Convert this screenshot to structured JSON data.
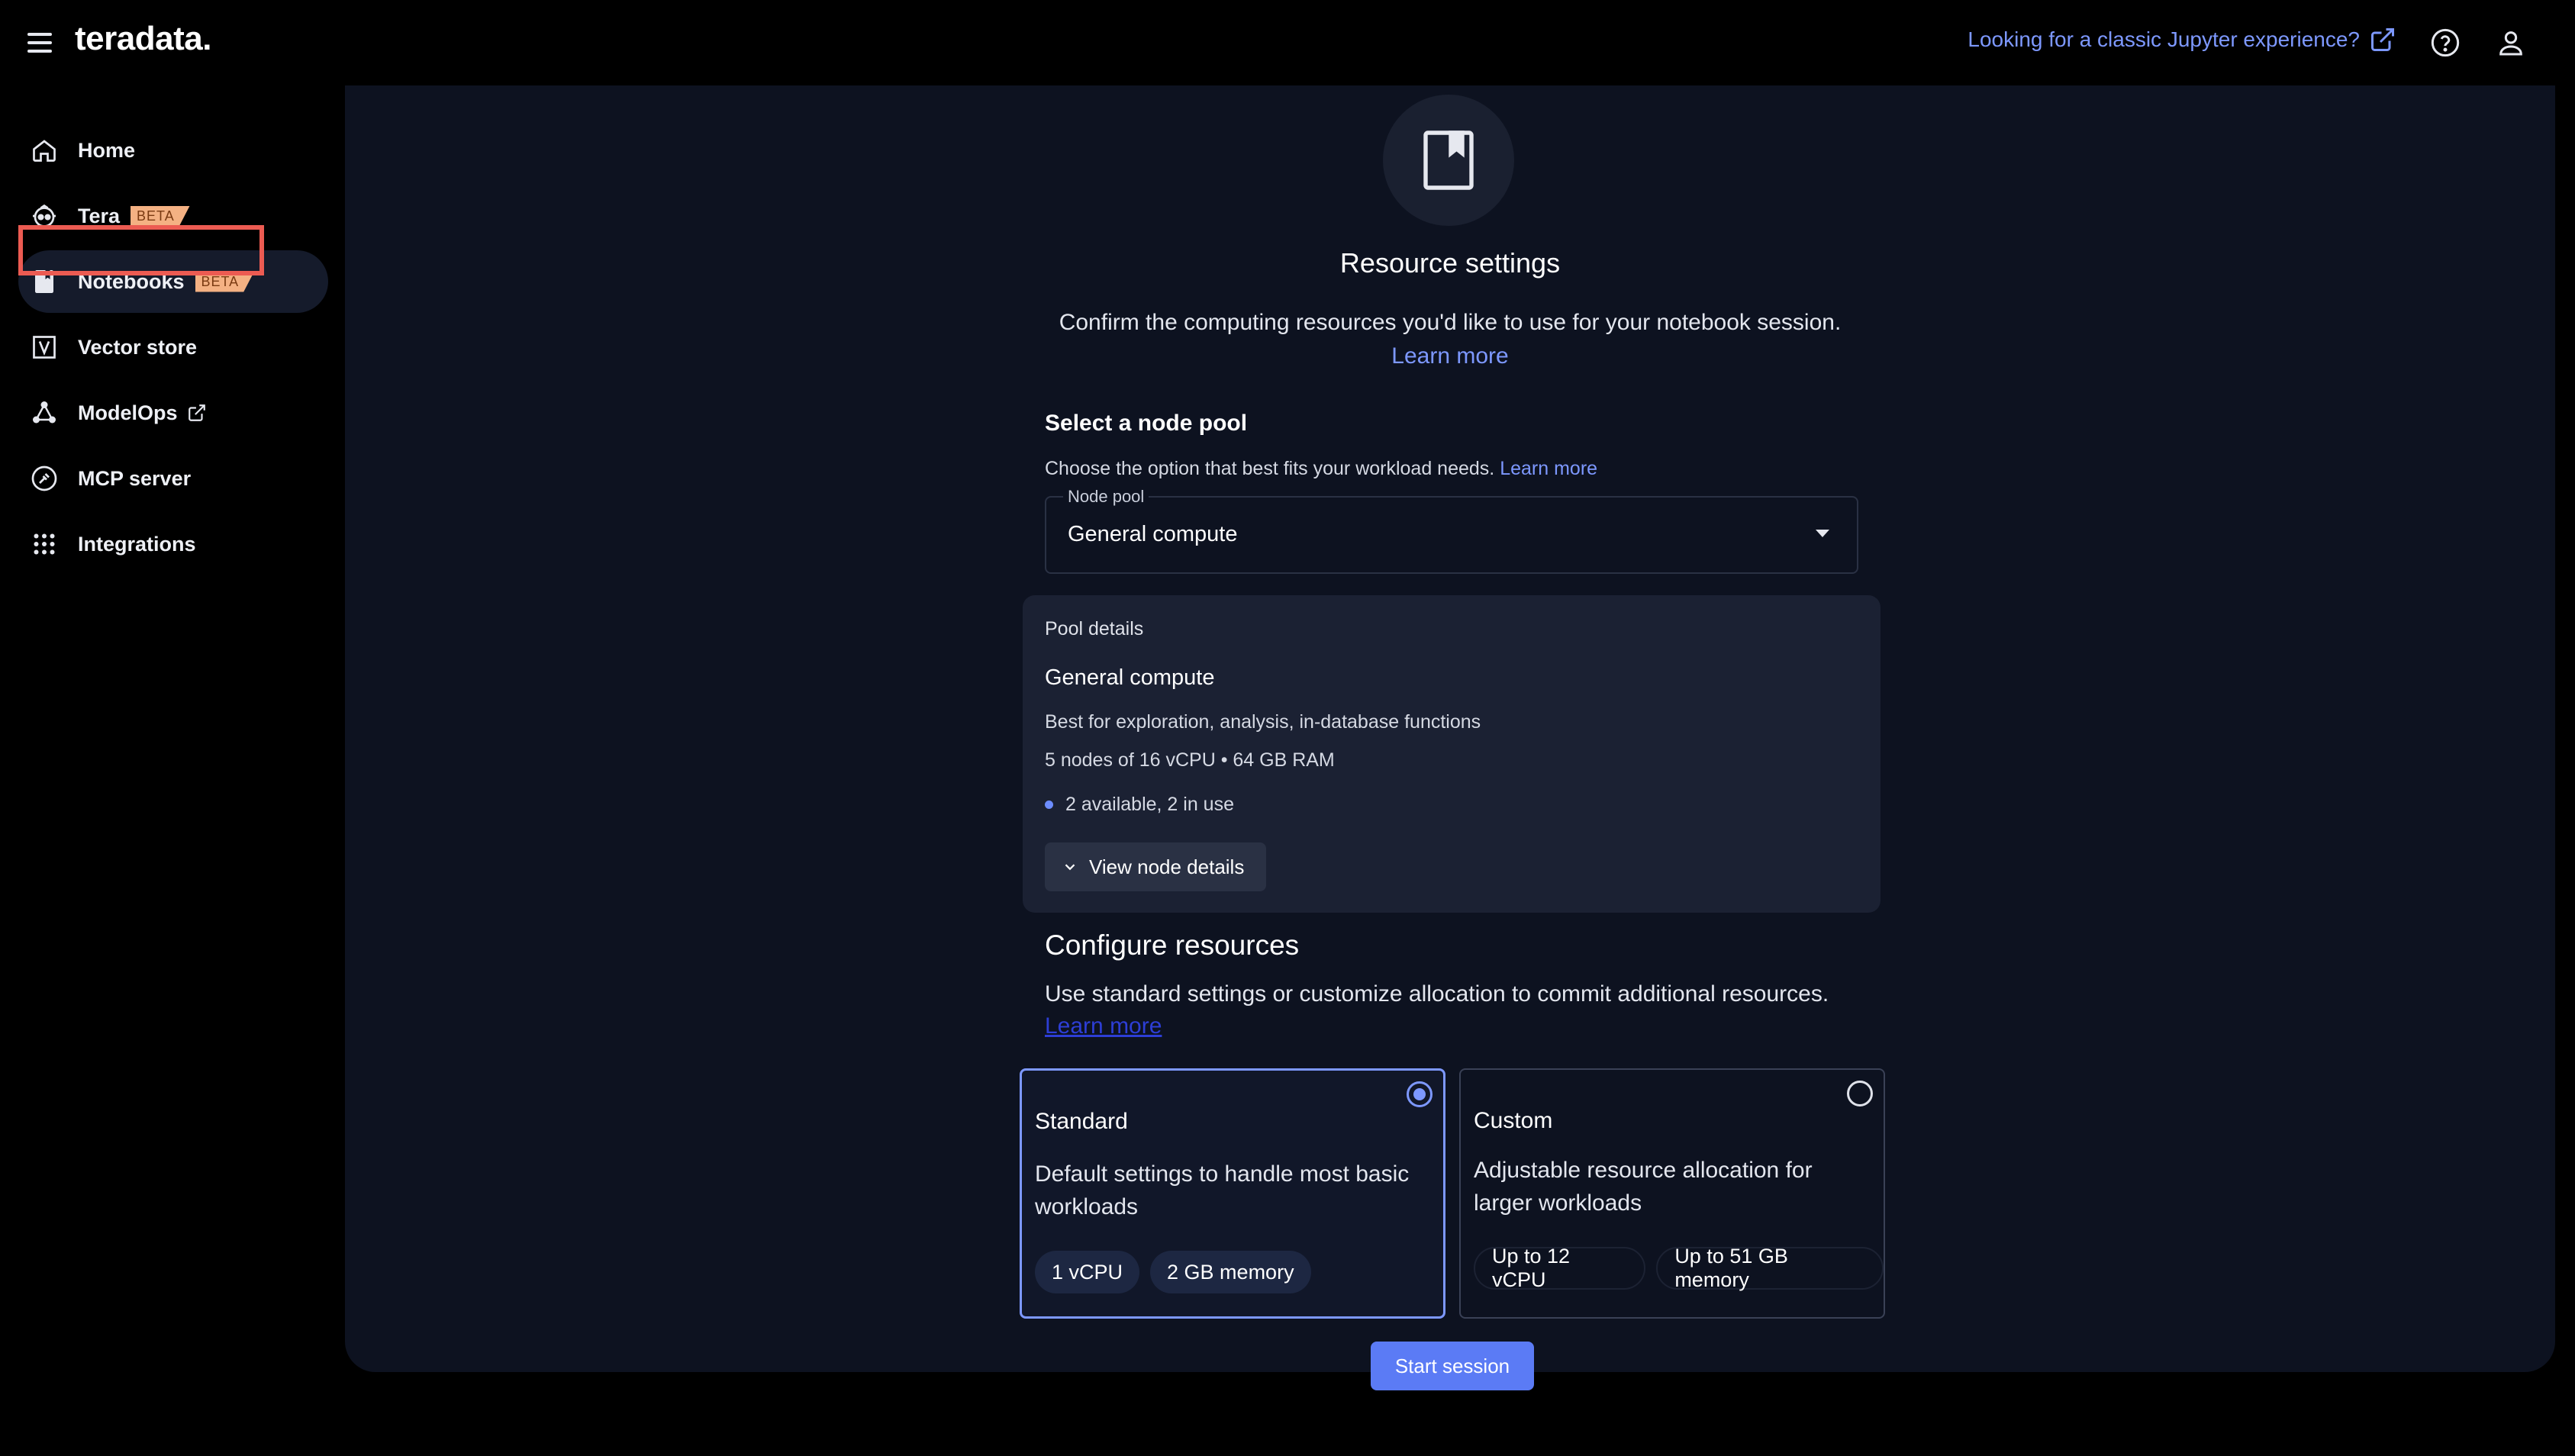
{
  "app": {
    "logo": "teradata."
  },
  "header": {
    "classic_link": "Looking for a classic Jupyter experience?",
    "icons": [
      "menu-icon",
      "external-link-icon",
      "help-icon",
      "user-icon"
    ]
  },
  "sidebar": {
    "items": [
      {
        "label": "Home",
        "icon": "home-icon"
      },
      {
        "label": "Tera",
        "icon": "robot-icon",
        "badge": "BETA"
      },
      {
        "label": "Notebooks",
        "icon": "notebook-icon",
        "badge": "BETA",
        "active": true
      },
      {
        "label": "Vector store",
        "icon": "vector-icon"
      },
      {
        "label": "ModelOps",
        "icon": "modelops-icon",
        "external": true
      },
      {
        "label": "MCP server",
        "icon": "mcp-icon"
      },
      {
        "label": "Integrations",
        "icon": "grid-icon"
      }
    ]
  },
  "main": {
    "title": "Resource settings",
    "subtitle": "Confirm the computing resources you'd like to use for your notebook session.",
    "learn_more": "Learn more",
    "node_pool_section": {
      "heading": "Select a node pool",
      "description": "Choose the option that best fits your workload needs.",
      "learn_more": "Learn more",
      "select_label": "Node pool",
      "select_value": "General compute"
    },
    "pool_details": {
      "label": "Pool details",
      "name": "General compute",
      "description": "Best for exploration, analysis, in-database functions",
      "spec": "5 nodes of 16 vCPU • 64 GB RAM",
      "availability": "2 available, 2 in use",
      "view_button": "View node details"
    },
    "configure": {
      "heading": "Configure resources",
      "description": "Use standard settings or customize allocation to commit additional resources.",
      "learn_more": "Learn more",
      "options": [
        {
          "title": "Standard",
          "description": "Default settings to handle most basic workloads",
          "chips": [
            "1 vCPU",
            "2 GB memory"
          ],
          "selected": true
        },
        {
          "title": "Custom",
          "description": "Adjustable resource allocation for larger workloads",
          "chips": [
            "Up to 12 vCPU",
            "Up to 51 GB memory"
          ],
          "selected": false
        }
      ]
    },
    "start_button": "Start session"
  },
  "colors": {
    "accent": "#7d98ff",
    "primary_button": "#5b7bf5",
    "badge": "#f4b183",
    "highlight": "#ec5b52"
  }
}
